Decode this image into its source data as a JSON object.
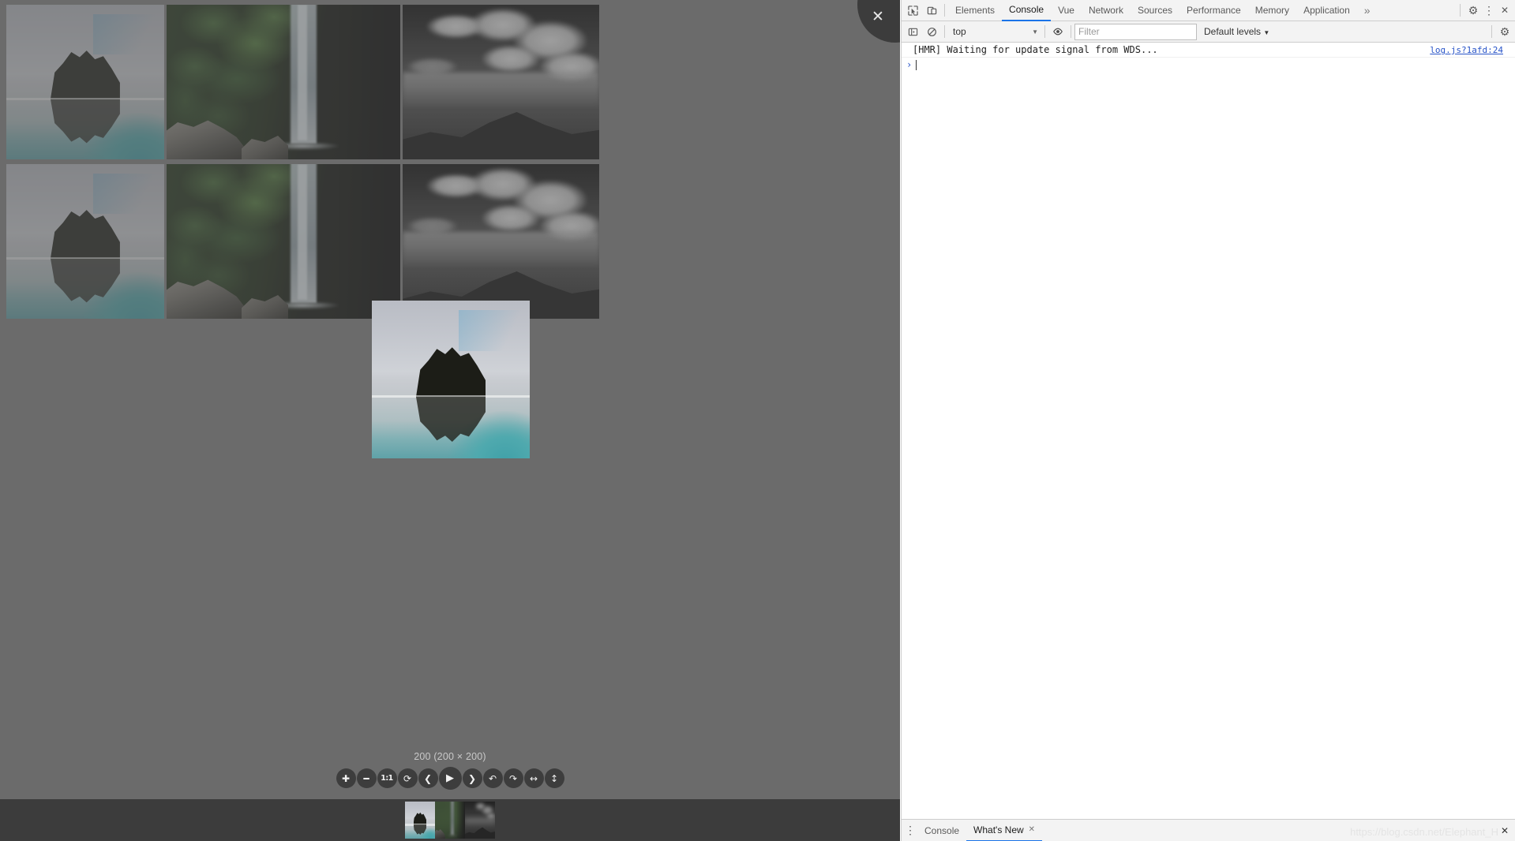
{
  "viewer": {
    "close_label": "✕",
    "zoom_readout": "200 (200 × 200)",
    "toolbar": [
      {
        "name": "zoom-in-button",
        "glyph": "✚",
        "size": "small"
      },
      {
        "name": "zoom-out-button",
        "glyph": "━",
        "size": "small"
      },
      {
        "name": "one-to-one-button",
        "glyph": "1:1",
        "size": "small"
      },
      {
        "name": "reset-button",
        "glyph": "⟳",
        "size": "small"
      },
      {
        "name": "previous-button",
        "glyph": "❮",
        "size": "small"
      },
      {
        "name": "play-button",
        "glyph": "▶",
        "size": "big"
      },
      {
        "name": "next-button",
        "glyph": "❯",
        "size": "small"
      },
      {
        "name": "rotate-left-button",
        "glyph": "↶",
        "size": "small"
      },
      {
        "name": "rotate-right-button",
        "glyph": "↷",
        "size": "small"
      },
      {
        "name": "flip-horizontal-button",
        "glyph": "↔",
        "size": "small"
      },
      {
        "name": "flip-vertical-button",
        "glyph": "↕",
        "size": "small"
      }
    ],
    "thumbnails": [
      {
        "art": "rock",
        "active": true
      },
      {
        "art": "waterfall",
        "active": false
      },
      {
        "art": "bw",
        "active": false
      }
    ],
    "preview_art": "rock"
  },
  "gallery": {
    "rows": [
      [
        {
          "art": "rock"
        },
        {
          "art": "waterfall"
        },
        {
          "art": "bw"
        }
      ],
      [
        {
          "art": "rock"
        },
        {
          "art": "waterfall"
        },
        {
          "art": "bw"
        }
      ]
    ]
  },
  "devtools": {
    "tabs": [
      {
        "label": "Elements",
        "active": false
      },
      {
        "label": "Console",
        "active": true
      },
      {
        "label": "Vue",
        "active": false
      },
      {
        "label": "Network",
        "active": false
      },
      {
        "label": "Sources",
        "active": false
      },
      {
        "label": "Performance",
        "active": false
      },
      {
        "label": "Memory",
        "active": false
      },
      {
        "label": "Application",
        "active": false
      }
    ],
    "more_tabs_glyph": "»",
    "filterbar": {
      "context": "top",
      "context_caret": "▼",
      "filter_placeholder": "Filter",
      "filter_value": "",
      "levels": "Default levels",
      "levels_caret": "▼"
    },
    "console": {
      "messages": [
        {
          "text": "[HMR] Waiting for update signal from WDS...",
          "source": "log.js?1afd:24"
        }
      ],
      "prompt_arrow": "›"
    },
    "drawer": {
      "tabs": [
        {
          "label": "Console",
          "active": false,
          "closable": false
        },
        {
          "label": "What's New",
          "active": true,
          "closable": true
        }
      ],
      "close_glyph": "✕",
      "menu_glyph": "⋮"
    },
    "settings_glyph": "⚙",
    "menu_glyph": "⋮",
    "close_glyph": "✕"
  },
  "watermark": {
    "text": "https://blog.csdn.net/Elephant_H"
  },
  "colors": {
    "accent": "#1a73e8",
    "page_bg": "#808080",
    "strip_bg": "#3c3c3c",
    "devtools_bg": "#ffffff",
    "toolbar_bg": "#f3f3f3",
    "link": "#2854c8"
  }
}
